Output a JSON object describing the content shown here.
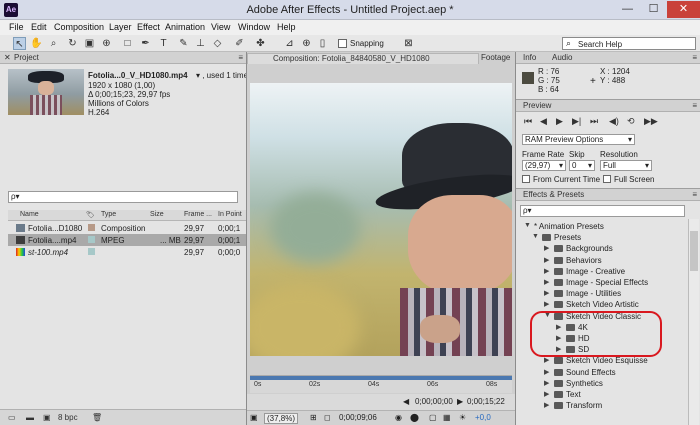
{
  "window": {
    "title": "Adobe After Effects - Untitled Project.aep *",
    "logo": "Ae",
    "minimize": "—",
    "maximize": "☐",
    "close": "✕"
  },
  "menu": [
    "File",
    "Edit",
    "Composition",
    "Layer",
    "Effect",
    "Animation",
    "View",
    "Window",
    "Help"
  ],
  "toolbar": {
    "snapping_label": "Snapping",
    "search_help_label": "Search Help"
  },
  "project": {
    "tab_label": "Project",
    "file": {
      "name": "Fotolia...0_V_HD1080.mp4",
      "used": "▾ , used 1 time",
      "resolution": "1920 x 1080 (1,00)",
      "duration": "Δ 0;00;15;23, 29,97 fps",
      "colors": "Millions of Colors",
      "codec": "H.264"
    },
    "search_placeholder": "ρ▾",
    "columns": [
      "Name",
      "Type",
      "Size",
      "Frame ...",
      "In Point"
    ],
    "rows": [
      {
        "name": "Fotolia...D1080",
        "type": "Composition",
        "size": "",
        "frame": "29,97",
        "in": "0;00;1",
        "color": "#b79a88"
      },
      {
        "name": "Fotolia....mp4",
        "type": "MPEG",
        "size": "... MB",
        "frame": "29,97",
        "in": "0;00;1",
        "color": "#a6c8c8"
      },
      {
        "name": "st-100.mp4",
        "type": "",
        "size": "",
        "frame": "29,97",
        "in": "0;00;0",
        "color": "#a6c8c8"
      }
    ],
    "bpc_label": "8 bpc"
  },
  "composition": {
    "tab_label": "Composition: Fotolia_84840580_V_HD1080",
    "footage_tab": "Footage",
    "ticks": [
      "0s",
      "02s",
      "04s",
      "06s",
      "08s"
    ],
    "zoom": "(37,8%)",
    "timecode": "0;00;09;06",
    "timecode2": "0;00;00;00",
    "timecode3": "0;00;15;22",
    "offset": "+0,0"
  },
  "info": {
    "tab_label": "Info",
    "audio_tab": "Audio",
    "r": "R : 76",
    "g": "G : 75",
    "b": "B : 64",
    "x": "X : 1204",
    "y": "Y : 488"
  },
  "preview": {
    "tab_label": "Preview",
    "ram_option": "RAM Preview Options",
    "frame_rate_label": "Frame Rate",
    "frame_rate_value": "(29,97)",
    "skip_label": "Skip",
    "skip_value": "0",
    "resolution_label": "Resolution",
    "resolution_value": "Full",
    "from_current": "From Current Time",
    "full_screen": "Full Screen"
  },
  "effects": {
    "tab_label": "Effects & Presets",
    "search_placeholder": "ρ▾",
    "items": [
      {
        "label": "* Animation Presets",
        "level": 0,
        "open": true,
        "folder": false
      },
      {
        "label": "Presets",
        "level": 1,
        "open": true,
        "folder": true
      },
      {
        "label": "Backgrounds",
        "level": 2,
        "open": false,
        "folder": true
      },
      {
        "label": "Behaviors",
        "level": 2,
        "open": false,
        "folder": true
      },
      {
        "label": "Image - Creative",
        "level": 2,
        "open": false,
        "folder": true
      },
      {
        "label": "Image - Special Effects",
        "level": 2,
        "open": false,
        "folder": true
      },
      {
        "label": "Image - Utilities",
        "level": 2,
        "open": false,
        "folder": true
      },
      {
        "label": "Sketch Video Artistic",
        "level": 2,
        "open": false,
        "folder": true
      },
      {
        "label": "Sketch Video Classic",
        "level": 2,
        "open": true,
        "folder": true
      },
      {
        "label": "4K",
        "level": 3,
        "open": false,
        "folder": true
      },
      {
        "label": "HD",
        "level": 3,
        "open": false,
        "folder": true
      },
      {
        "label": "SD",
        "level": 3,
        "open": false,
        "folder": true
      },
      {
        "label": "Sketch Video Esquisse",
        "level": 2,
        "open": false,
        "folder": true
      },
      {
        "label": "Sound Effects",
        "level": 2,
        "open": false,
        "folder": true
      },
      {
        "label": "Synthetics",
        "level": 2,
        "open": false,
        "folder": true
      },
      {
        "label": "Text",
        "level": 2,
        "open": false,
        "folder": true
      },
      {
        "label": "Transform",
        "level": 2,
        "open": false,
        "folder": true
      }
    ]
  }
}
